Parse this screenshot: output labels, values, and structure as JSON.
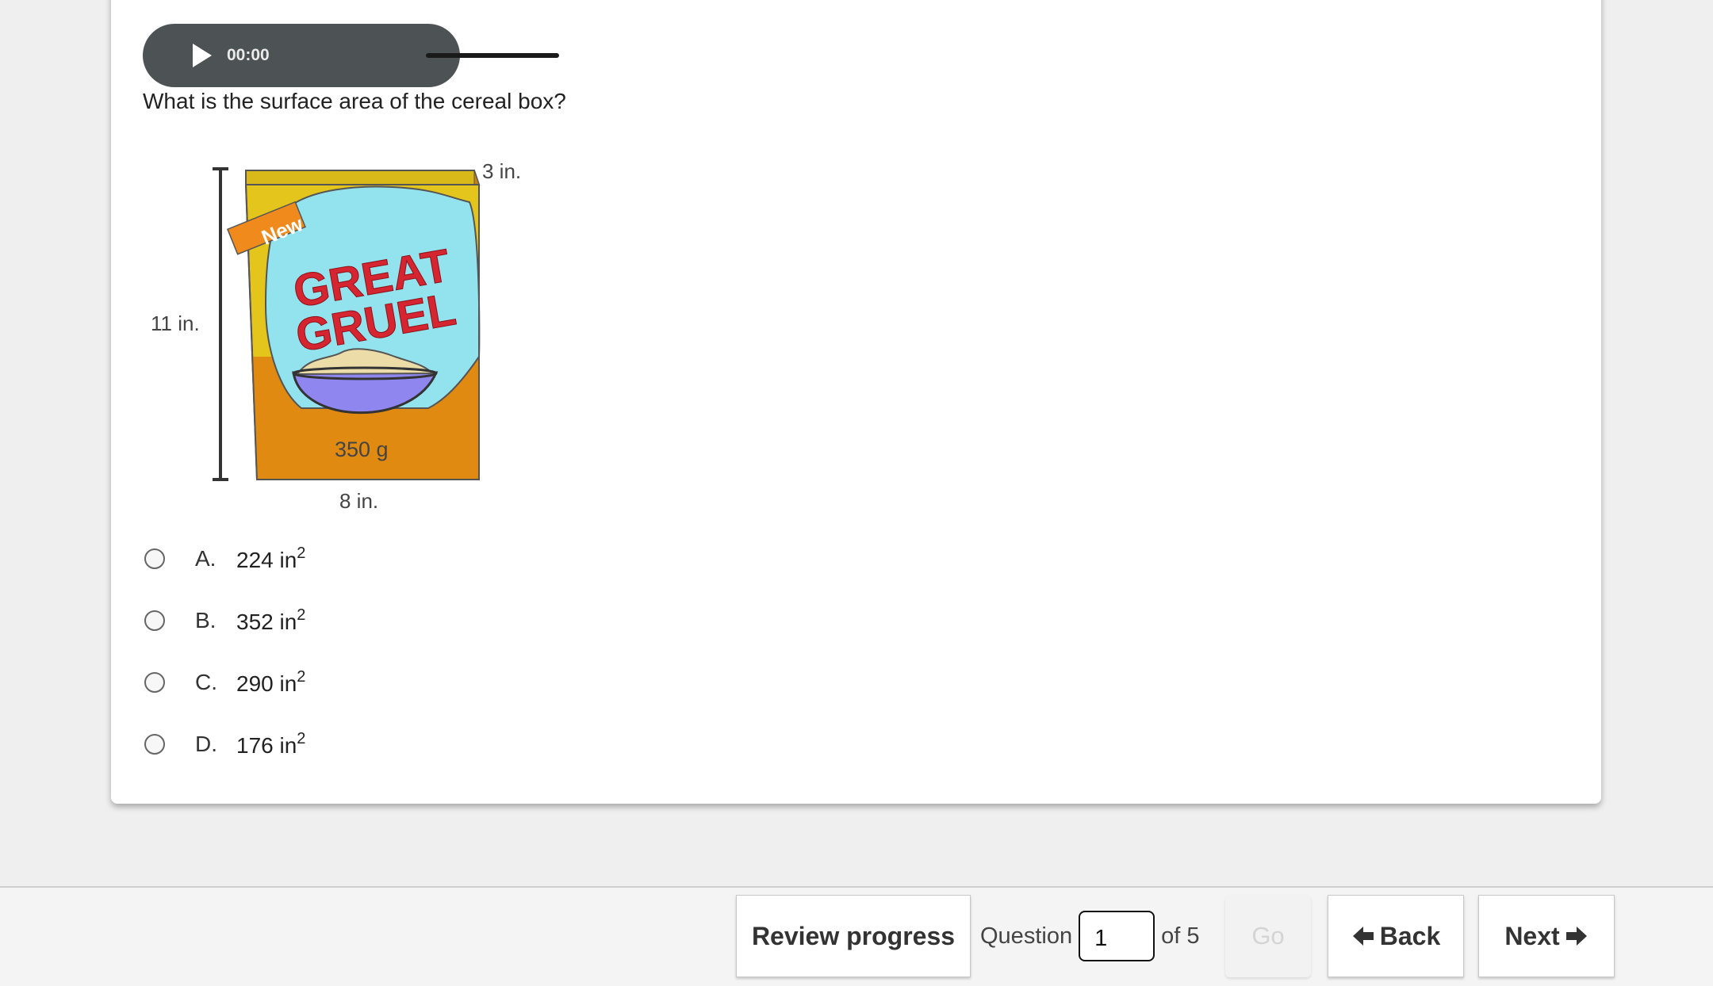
{
  "audio": {
    "time": "00:00"
  },
  "question": {
    "text": "What is the surface area of the cereal box?"
  },
  "figure": {
    "depth_label": "3 in.",
    "height_label": "11 in.",
    "width_label": "8 in.",
    "badge_text": "New",
    "brand_line1": "GREAT",
    "brand_line2": "GRUEL",
    "weight_text": "350 g"
  },
  "choices": [
    {
      "letter": "A.",
      "value": "224 in",
      "exp": "2"
    },
    {
      "letter": "B.",
      "value": "352 in",
      "exp": "2"
    },
    {
      "letter": "C.",
      "value": "290 in",
      "exp": "2"
    },
    {
      "letter": "D.",
      "value": "176 in",
      "exp": "2"
    }
  ],
  "footer": {
    "review_label": "Review progress",
    "question_label": "Question",
    "question_value": "1",
    "of_label": "of 5",
    "go_label": "Go",
    "back_label": "Back",
    "next_label": "Next"
  },
  "colors": {
    "player_bg": "#4d5254",
    "box_yellow": "#e3c51c",
    "box_orange": "#e08a12",
    "sky_blue": "#93e3ee",
    "brand_red": "#d42530",
    "bowl_purple": "#8f86f0"
  }
}
